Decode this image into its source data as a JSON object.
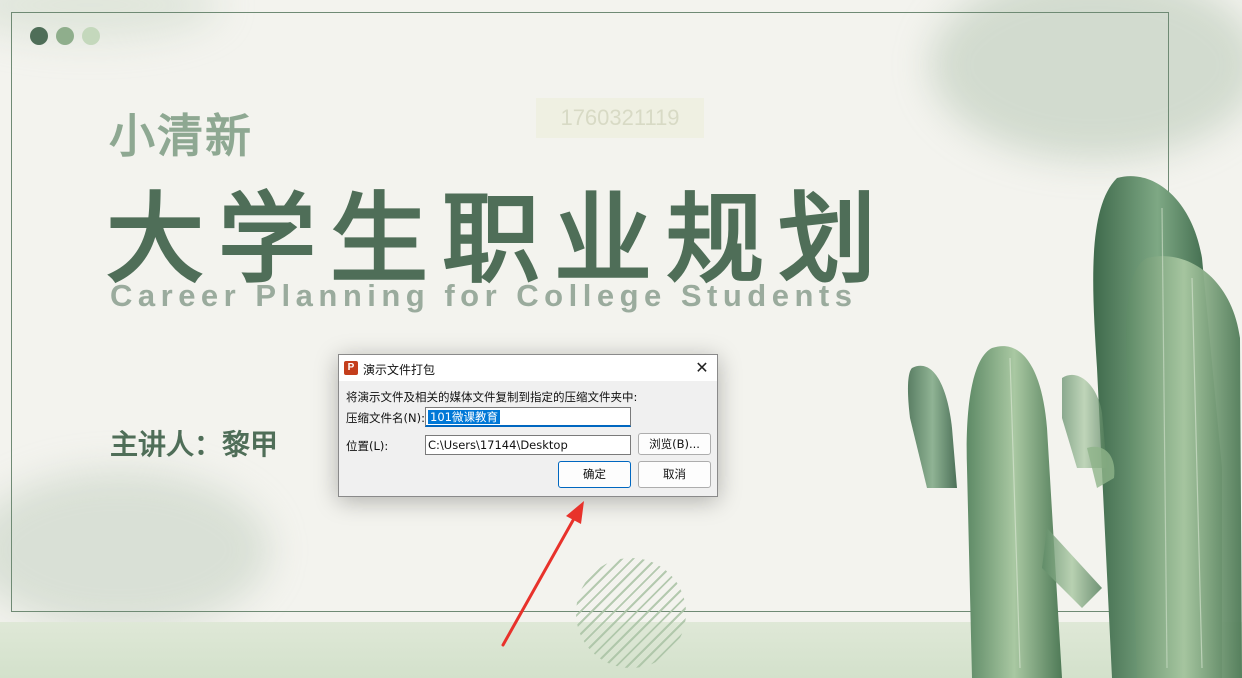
{
  "slide": {
    "subtitle": "小清新",
    "title": "大学生职业规划",
    "english_title": "Career Planning for College Students",
    "presenter": "主讲人：黎甲",
    "watermark": "1760321119",
    "colors": {
      "title": "#4f6e58",
      "subtitle": "#8ea892",
      "english": "#9aab9d",
      "frame": "#6f8a74"
    }
  },
  "dialog": {
    "title": "演示文件打包",
    "app_icon_letter": "P",
    "description": "将演示文件及相关的媒体文件复制到指定的压缩文件夹中:",
    "name_label": "压缩文件名(N):",
    "name_value": "101微课教育",
    "location_label": "位置(L):",
    "location_value": "C:\\Users\\17144\\Desktop",
    "browse_label": "浏览(B)...",
    "ok_label": "确定",
    "cancel_label": "取消",
    "close_glyph": "✕"
  }
}
